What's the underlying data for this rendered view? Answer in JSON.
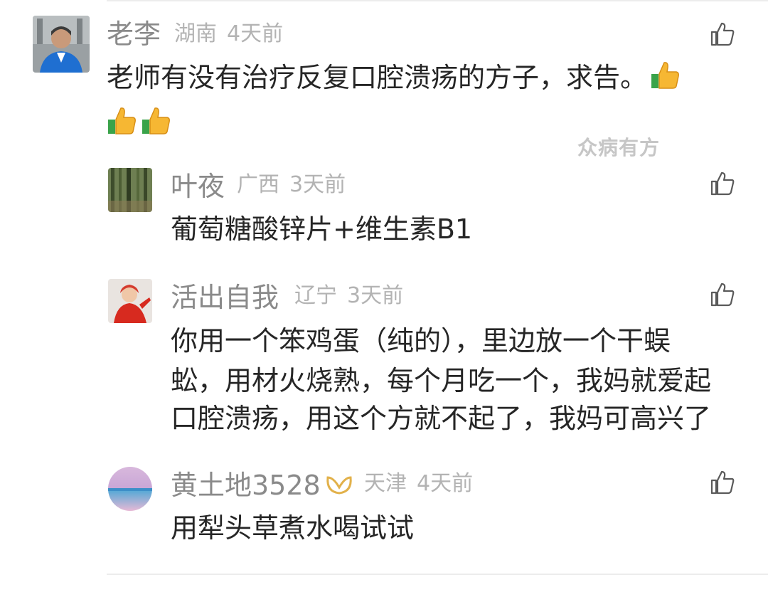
{
  "comments": [
    {
      "name": "老李",
      "region": "湖南",
      "time": "4天前",
      "text_line1": "老师有没有治疗反复口腔溃疡的方子，求告。",
      "emojis": [
        "thumbs-up-emoji",
        "thumbs-up-emoji",
        "thumbs-up-emoji"
      ]
    }
  ],
  "watermark": "众病有方",
  "replies": [
    {
      "name": "叶夜",
      "region": "广西",
      "time": "3天前",
      "text": "葡萄糖酸锌片+维生素B1"
    },
    {
      "name": "活出自我",
      "region": "辽宁",
      "time": "3天前",
      "lines": [
        "你用一个笨鸡蛋（纯的），里边放一个干蜈",
        "蚣，用材火烧熟，每个月吃一个，我妈就爱起",
        "口腔溃疡，用这个方就不起了，我妈可高兴了"
      ]
    },
    {
      "name": "黄土地3528",
      "badge": "vip-badge-icon",
      "region": "天津",
      "time": "4天前",
      "text": "用犁头草煮水喝试试"
    }
  ],
  "colors": {
    "name": "#8a8a8a",
    "meta": "#b3b3b3",
    "text": "#262626",
    "badge": "#e2b14a",
    "emoji_thumb": "#f6b733",
    "emoji_cuff": "#3aa34a"
  }
}
